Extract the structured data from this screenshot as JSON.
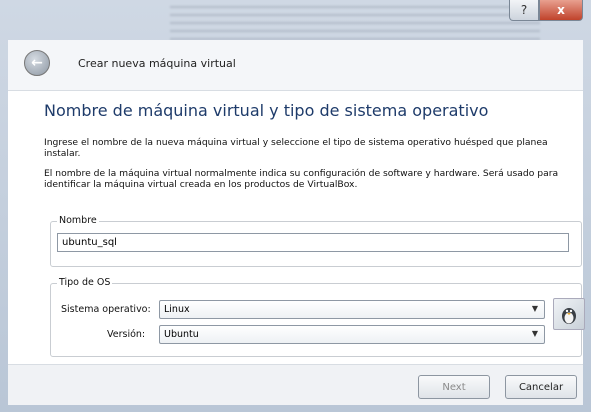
{
  "window": {
    "help_glyph": "?",
    "close_glyph": "x"
  },
  "header": {
    "title": "Crear nueva máquina virtual",
    "back_icon": "back-arrow-icon"
  },
  "page": {
    "title": "Nombre de máquina virtual y tipo de sistema operativo",
    "paragraph1": "Ingrese el nombre de la nueva máquina virtual y seleccione el tipo de sistema operativo huésped que planea instalar.",
    "paragraph2": "El nombre de la máquina virtual normalmente indica su configuración de software y hardware. Será usado para identificar la máquina virtual creada en los productos de VirtualBox."
  },
  "name_group": {
    "label": "Nombre",
    "value": "ubuntu_sql"
  },
  "os_group": {
    "label": "Tipo de OS",
    "os_label": "Sistema operativo:",
    "os_value": "Linux",
    "version_label": "Versión:",
    "version_value": "Ubuntu",
    "os_icon": "linux-penguin-icon"
  },
  "footer": {
    "next_label": "Next",
    "cancel_label": "Cancelar"
  }
}
